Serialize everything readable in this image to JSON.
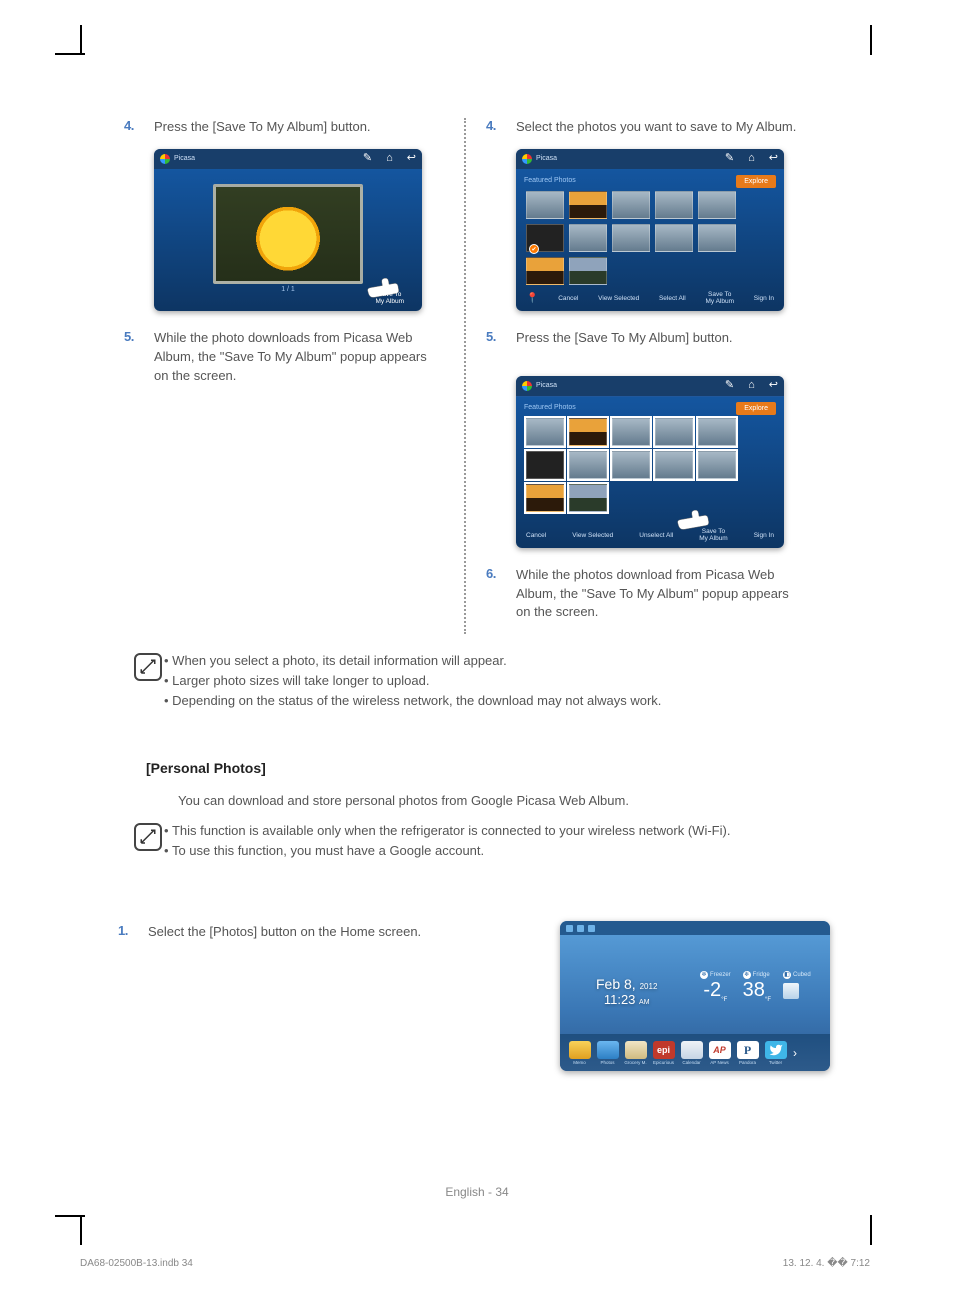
{
  "left": {
    "step4": {
      "num": "4.",
      "text": "Press the [Save To My Album] button."
    },
    "step5": {
      "num": "5.",
      "text": "While the photo downloads from Picasa Web Album, the \"Save To My Album\" popup appears on the screen."
    },
    "picasa_title": "Picasa",
    "page_indicator": "1 / 1",
    "save_to_label": "Save To\nMy Album"
  },
  "right": {
    "step4": {
      "num": "4.",
      "text": "Select the photos you want to save to My Album."
    },
    "step5": {
      "num": "5.",
      "text": "Press the [Save To My Album] button."
    },
    "step6": {
      "num": "6.",
      "text": "While the photos download from Picasa Web Album, the \"Save To My Album\" popup appears on the screen."
    },
    "featured": "Featured Photos",
    "explore": "Explore",
    "bar1": {
      "cancel": "Cancel",
      "view": "View Selected",
      "select": "Select All",
      "save": "Save To\nMy Album",
      "signin": "Sign In"
    },
    "bar2": {
      "cancel": "Cancel",
      "view": "View Selected",
      "unselect": "Unselect All",
      "save": "Save To\nMy Album",
      "signin": "Sign In"
    }
  },
  "notes1": [
    "When you select a photo, its detail information will appear.",
    "Larger photo sizes will take longer to upload.",
    "Depending on the status of the wireless network, the download may not always work."
  ],
  "section": {
    "title": "[Personal Photos]",
    "intro": "You can download and store personal photos from Google Picasa Web Album."
  },
  "notes2": [
    "This function is available only when the refrigerator is connected to your wireless network (Wi-Fi).",
    "To use this function, you must have a Google account."
  ],
  "pp_step1": {
    "num": "1.",
    "text": "Select the [Photos] button on the Home screen."
  },
  "home": {
    "date_main": "Feb 8,",
    "date_year": "2012",
    "time_main": "11:23",
    "time_suffix": "AM",
    "freezer": {
      "label": "Freezer",
      "val": "-2",
      "unit": "°F"
    },
    "fridge": {
      "label": "Fridge",
      "val": "38",
      "unit": "°F"
    },
    "cubed": {
      "label": "Cubed"
    },
    "apps": [
      "Memo",
      "Photos",
      "Grocery M.",
      "Epicurious",
      "Calendar",
      "AP News",
      "Pandora",
      "Twitter"
    ],
    "app_epi": "epi",
    "app_ap": "AP",
    "app_p": "P"
  },
  "footer": {
    "page": "English - 34",
    "file": "DA68-02500B-13.indb   34",
    "ts": "13. 12. 4.   �� 7:12"
  }
}
